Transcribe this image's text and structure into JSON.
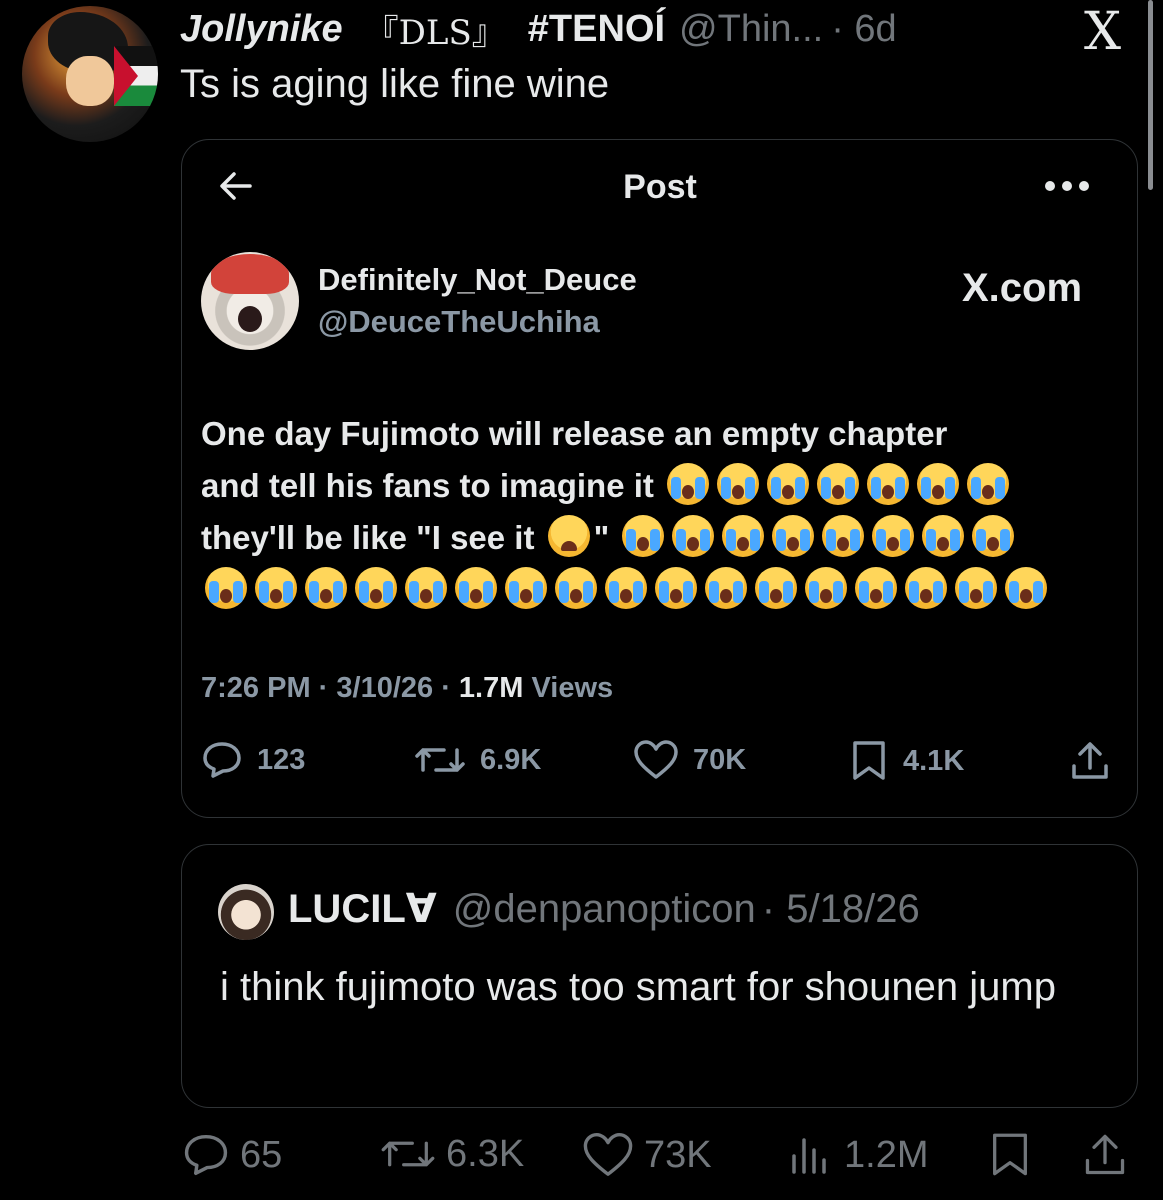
{
  "tweet": {
    "display_name": "Jollynike",
    "name_badge": "『DLS』",
    "hashtag": "#TENOÍ",
    "handle": "@Thin...",
    "age": "· 6d",
    "text": "Ts is aging like fine wine",
    "x_logo": "X"
  },
  "embedded_post": {
    "header_title": "Post",
    "author_name": "Definitely_Not_Deuce",
    "author_handle": "@DeuceTheUchiha",
    "site_label": "X.com",
    "body_line1": "One day Fujimoto will release an empty chapter",
    "body_line2": "and tell his fans to imagine it",
    "body_line3_prefix": "they'll be like \"I see it",
    "body_line3_suffix": "\"",
    "emoji_name": "loudly-crying-face",
    "emoji_counts": {
      "line2": 7,
      "line3_after": 8,
      "line4": 17
    },
    "time": "7:26 PM",
    "date": "· 3/10/26 ·",
    "views_value": "1.7M",
    "views_label": "Views",
    "stats": {
      "replies": "123",
      "reposts": "6.9K",
      "likes": "70K",
      "bookmarks": "4.1K"
    }
  },
  "quoted": {
    "name": "LUCIL∀",
    "handle": "@denpanopticon",
    "date": "· 5/18/26",
    "text": "i think fujimoto was too smart for shounen jump"
  },
  "actions": {
    "replies": "65",
    "reposts": "6.3K",
    "likes": "73K",
    "views": "1.2M"
  }
}
